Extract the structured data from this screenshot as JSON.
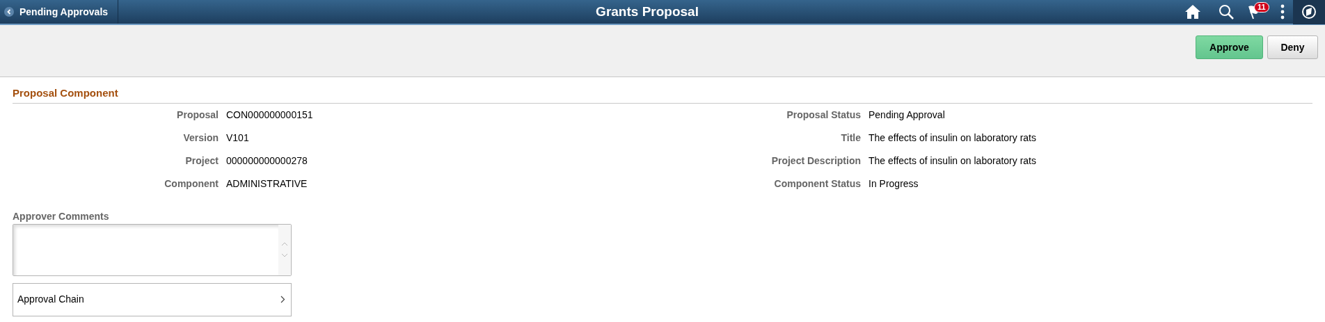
{
  "header": {
    "back_label": "Pending Approvals",
    "title": "Grants Proposal",
    "notification_count": "11"
  },
  "actions": [
    {
      "label": "Approve",
      "kind": "primary"
    },
    {
      "label": "Deny",
      "kind": "secondary"
    }
  ],
  "section": {
    "title": "Proposal Component"
  },
  "fields_left": [
    {
      "label": "Proposal",
      "value": "CON000000000151"
    },
    {
      "label": "Version",
      "value": "V101"
    },
    {
      "label": "Project",
      "value": "000000000000278"
    },
    {
      "label": "Component",
      "value": "ADMINISTRATIVE"
    }
  ],
  "fields_right": [
    {
      "label": "Proposal Status",
      "value": "Pending Approval"
    },
    {
      "label": "Title",
      "value": "The effects of insulin on laboratory rats"
    },
    {
      "label": "Project Description",
      "value": "The effects of insulin on laboratory rats"
    },
    {
      "label": "Component Status",
      "value": "In Progress"
    }
  ],
  "comments": {
    "label": "Approver Comments"
  },
  "approval_chain": {
    "label": "Approval Chain"
  }
}
